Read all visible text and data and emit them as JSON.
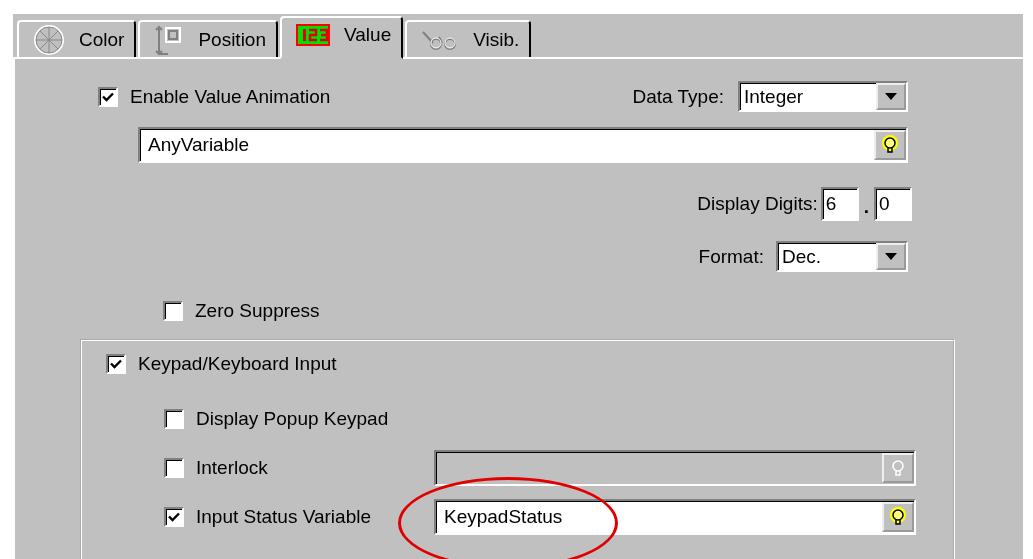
{
  "tabs": [
    {
      "label": "Color",
      "selected": false
    },
    {
      "label": "Position",
      "selected": false
    },
    {
      "label": "Value",
      "selected": true
    },
    {
      "label": "Visib.",
      "selected": false
    }
  ],
  "enable_value_animation": {
    "label": "Enable Value Animation",
    "checked": true
  },
  "data_type": {
    "label": "Data Type:",
    "value": "Integer"
  },
  "variable_field": {
    "value": "AnyVariable"
  },
  "display_digits": {
    "label": "Display Digits:",
    "integer": "6",
    "separator": ".",
    "decimal": "0"
  },
  "format": {
    "label": "Format:",
    "value": "Dec."
  },
  "zero_suppress": {
    "label": "Zero Suppress",
    "checked": false
  },
  "keypad_group": {
    "label": "Keypad/Keyboard Input",
    "checked": true,
    "options": [
      {
        "kind": "checkbox",
        "label": "Display Popup Keypad",
        "checked": false
      },
      {
        "kind": "checkbox-field",
        "label": "Interlock",
        "checked": false,
        "disabled": true,
        "highlighted": false
      },
      {
        "kind": "checkbox-field",
        "label": "Input Status Variable",
        "checked": true,
        "disabled": false,
        "value": "KeypadStatus",
        "highlighted": true
      }
    ]
  }
}
